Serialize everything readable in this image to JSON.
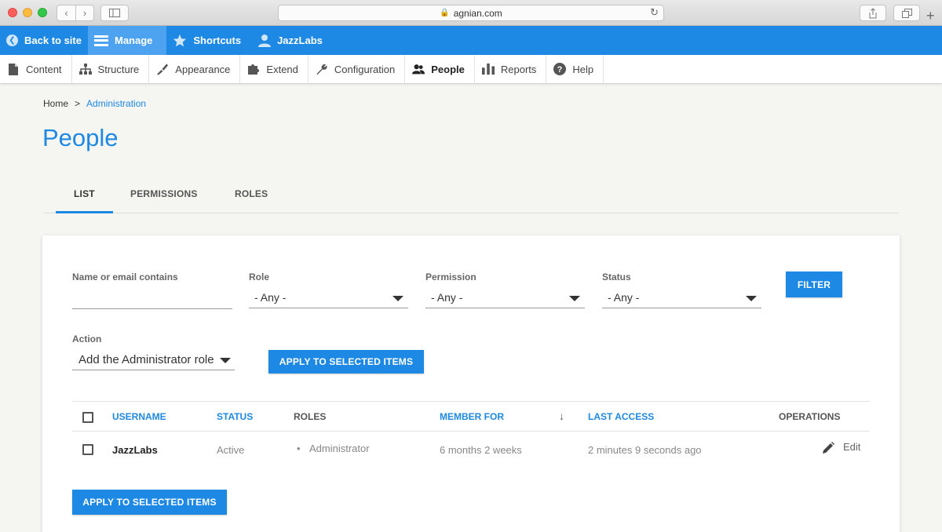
{
  "browser": {
    "url": "agnian.com"
  },
  "toolbar": {
    "back_label": "Back to site",
    "manage_label": "Manage",
    "shortcuts_label": "Shortcuts",
    "user_label": "JazzLabs"
  },
  "tray": {
    "items": [
      {
        "label": "Content",
        "icon": "document-icon"
      },
      {
        "label": "Structure",
        "icon": "hierarchy-icon"
      },
      {
        "label": "Appearance",
        "icon": "brush-icon"
      },
      {
        "label": "Extend",
        "icon": "puzzle-icon"
      },
      {
        "label": "Configuration",
        "icon": "wrench-icon"
      },
      {
        "label": "People",
        "icon": "people-icon"
      },
      {
        "label": "Reports",
        "icon": "bar-chart-icon"
      },
      {
        "label": "Help",
        "icon": "help-icon"
      }
    ],
    "active": "People"
  },
  "breadcrumb": {
    "home": "Home",
    "separator": ">",
    "current": "Administration"
  },
  "page_title": "People",
  "tabs": [
    {
      "label": "LIST",
      "active": true
    },
    {
      "label": "PERMISSIONS",
      "active": false
    },
    {
      "label": "ROLES",
      "active": false
    }
  ],
  "filters": {
    "name_label": "Name or email contains",
    "name_value": "",
    "role_label": "Role",
    "role_value": "- Any -",
    "permission_label": "Permission",
    "permission_value": "- Any -",
    "status_label": "Status",
    "status_value": "- Any -",
    "filter_button": "FILTER"
  },
  "action": {
    "label": "Action",
    "value": "Add the Administrator role",
    "apply_button": "APPLY TO SELECTED ITEMS"
  },
  "table": {
    "headers": {
      "username": "USERNAME",
      "status": "STATUS",
      "roles": "ROLES",
      "member_for": "MEMBER FOR",
      "sort_indicator": "↓",
      "last_access": "LAST ACCESS",
      "operations": "OPERATIONS"
    },
    "rows": [
      {
        "username": "JazzLabs",
        "status": "Active",
        "role": "Administrator",
        "member_for": "6 months 2 weeks",
        "last_access": "2 minutes 9 seconds ago",
        "operation": "Edit"
      }
    ]
  },
  "bottom_apply_button": "APPLY TO SELECTED ITEMS",
  "colors": {
    "accent": "#1e88e5",
    "toolbar_active": "#4da3f0",
    "background": "#f5f5f2"
  }
}
